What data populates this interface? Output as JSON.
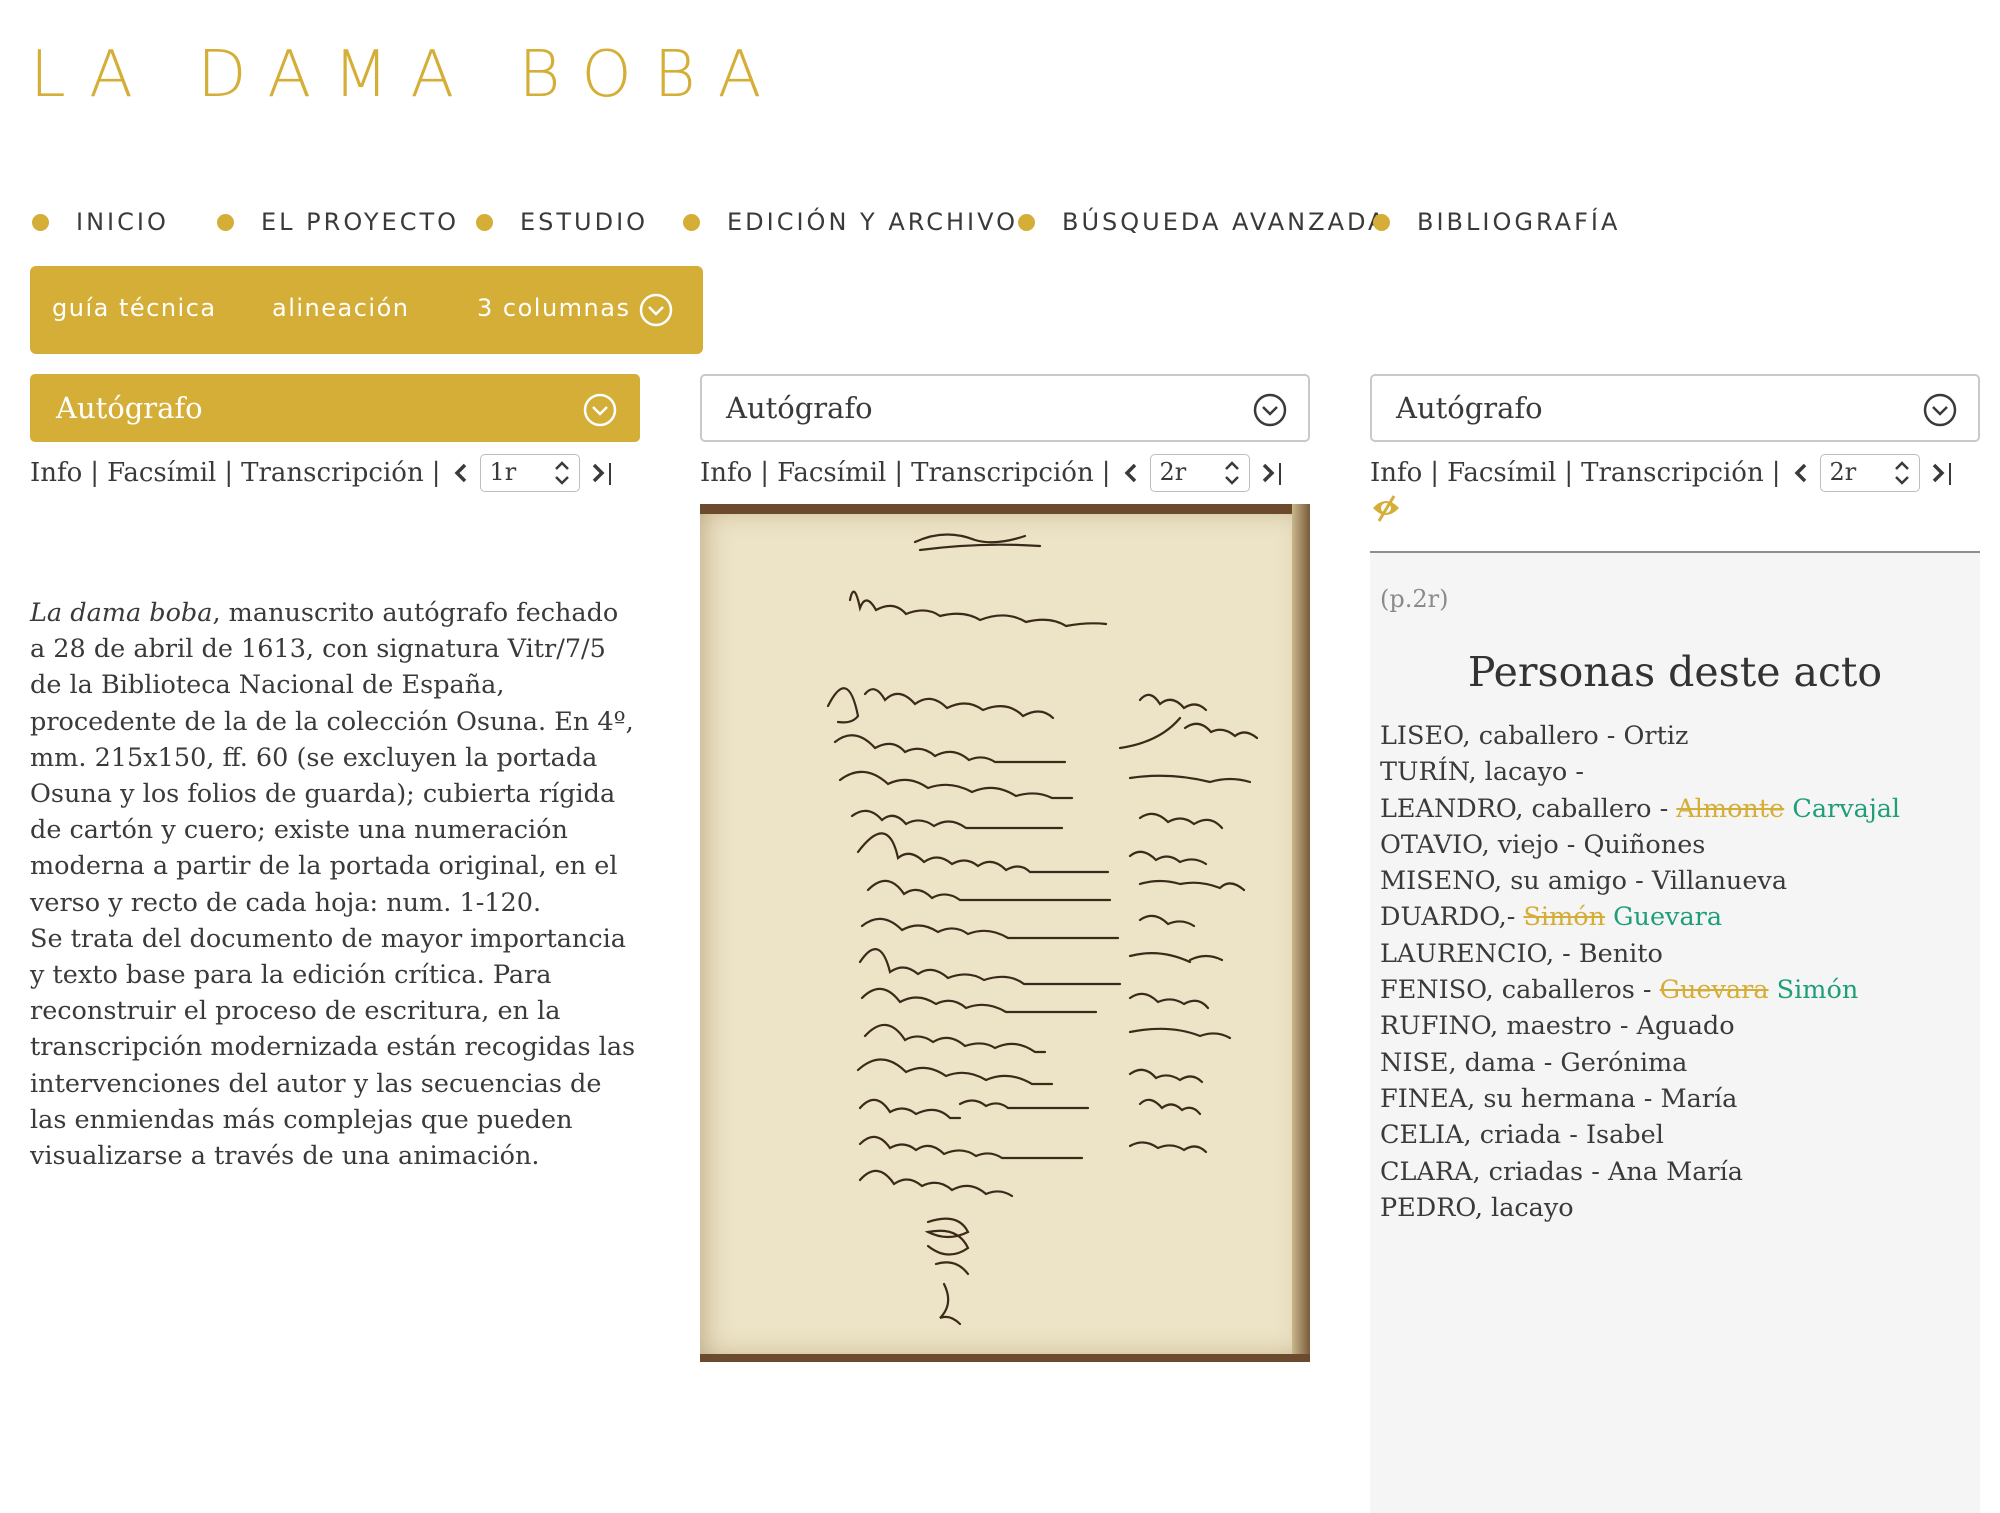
{
  "site": {
    "title": "LA DAMA BOBA"
  },
  "nav": {
    "items": [
      {
        "label": "INICIO"
      },
      {
        "label": "EL PROYECTO"
      },
      {
        "label": "ESTUDIO"
      },
      {
        "label": "EDICIÓN Y ARCHIVO"
      },
      {
        "label": "BÚSQUEDA AVANZADA"
      },
      {
        "label": "BIBLIOGRAFÍA"
      }
    ]
  },
  "toolbar": {
    "guide_label": "guía técnica",
    "align_label": "alineación",
    "columns_label": "3 columnas"
  },
  "colors": {
    "accent": "#d4ae37",
    "insertion": "#1f9e7a",
    "text": "#3a3a3a",
    "panel": "#f5f5f5"
  },
  "columns": [
    {
      "witness": "Autógrafo",
      "view_links": [
        "Info",
        "Facsímil",
        "Transcripción"
      ],
      "page": "1r",
      "info": {
        "title_italic": "La dama boba",
        "p1": ", manuscrito autógrafo fechado a 28 de abril de 1613, con signatura Vitr/7/5 de la Biblioteca Nacional de España, procedente de la de la colección Osuna. En 4º, mm. 215x150, ff. 60 (se excluyen la portada Osuna y los folios de guarda); cubierta rígida de cartón y cuero; existe una numeración moderna a partir de la portada original, en el verso y recto de cada hoja: num. 1-120.",
        "p2": "Se trata del documento de mayor importancia y texto base para la edición crítica. Para reconstruir el proceso de escritura, en la transcripción modernizada están recogidas las intervenciones del autor y las secuencias de las enmiendas más complejas que pueden visualizarse a través de una animación."
      }
    },
    {
      "witness": "Autógrafo",
      "view_links": [
        "Info",
        "Facsímil",
        "Transcripción"
      ],
      "page": "2r"
    },
    {
      "witness": "Autógrafo",
      "view_links": [
        "Info",
        "Facsímil",
        "Transcripción"
      ],
      "page": "2r",
      "transcription": {
        "page_ref": "(p.2r)",
        "title": "Personas deste acto",
        "characters": [
          {
            "text": "LISEO, caballero - Ortiz"
          },
          {
            "text": "TURÍN, lacayo -"
          },
          {
            "text": "LEANDRO, caballero - ",
            "deleted": "Almonte",
            "inserted": "Carvajal"
          },
          {
            "text": "OTAVIO, viejo - Quiñones"
          },
          {
            "text": "MISENO, su amigo - Villanueva"
          },
          {
            "text": "DUARDO,- ",
            "deleted": "Simón",
            "inserted": "Guevara"
          },
          {
            "text": "LAURENCIO, - Benito"
          },
          {
            "text": "FENISO, caballeros - ",
            "deleted": "Guevara",
            "inserted": "Simón"
          },
          {
            "text": "RUFINO, maestro - Aguado"
          },
          {
            "text": "NISE, dama - Gerónima"
          },
          {
            "text": "FINEA, su hermana - María"
          },
          {
            "text": "CELIA, criada - Isabel"
          },
          {
            "text": "CLARA, criadas - Ana María"
          },
          {
            "text": "PEDRO, lacayo"
          }
        ]
      }
    }
  ]
}
